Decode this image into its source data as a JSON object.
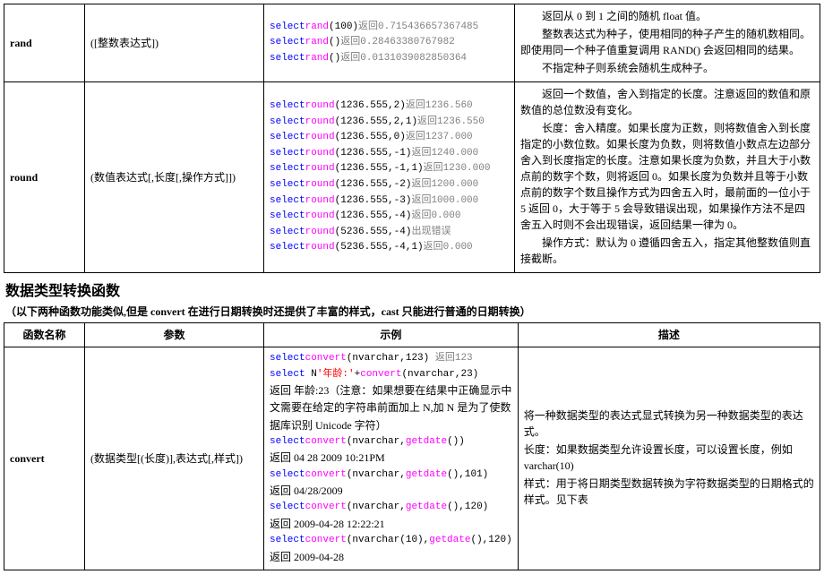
{
  "table1": {
    "rows": [
      {
        "name": "rand",
        "params": "([整数表达式])",
        "examples": [
          {
            "prefix": "select",
            "func": "rand",
            "args": "(100)",
            "ret": "返回0.715436657367485"
          },
          {
            "prefix": "select",
            "func": "rand",
            "args": "()",
            "ret": "返回0.28463380767982"
          },
          {
            "prefix": "select",
            "func": "rand",
            "args": "()",
            "ret": "返回0.0131039082850364"
          }
        ],
        "desc": [
          "　　返回从 0 到 1 之间的随机 float 值。",
          "　　整数表达式为种子，使用相同的种子产生的随机数相同。即使用同一个种子值重复调用 RAND() 会返回相同的结果。",
          "　　不指定种子则系统会随机生成种子。"
        ]
      },
      {
        "name": "round",
        "params": "(数值表达式[,长度[,操作方式]])",
        "examples": [
          {
            "prefix": "select",
            "func": "round",
            "args": "(1236.555,2)",
            "ret": "返回1236.560"
          },
          {
            "prefix": "select",
            "func": "round",
            "args": "(1236.555,2,1)",
            "ret": "返回1236.550"
          },
          {
            "prefix": "select",
            "func": "round",
            "args": "(1236.555,0)",
            "ret": "返回1237.000"
          },
          {
            "prefix": "select",
            "func": "round",
            "args": "(1236.555,-1)",
            "ret": "返回1240.000"
          },
          {
            "prefix": "select",
            "func": "round",
            "args": "(1236.555,-1,1)",
            "ret": "返回1230.000"
          },
          {
            "prefix": "select",
            "func": "round",
            "args": "(1236.555,-2)",
            "ret": "返回1200.000"
          },
          {
            "prefix": "select",
            "func": "round",
            "args": "(1236.555,-3)",
            "ret": "返回1000.000"
          },
          {
            "prefix": "select",
            "func": "round",
            "args": "(1236.555,-4)",
            "ret": "返回0.000"
          },
          {
            "prefix": "select",
            "func": "round",
            "args": "(5236.555,-4)",
            "ret": "出现错误"
          },
          {
            "prefix": "select",
            "func": "round",
            "args": "(5236.555,-4,1)",
            "ret": "返回0.000"
          }
        ],
        "desc": [
          "　　返回一个数值，舍入到指定的长度。注意返回的数值和原数值的总位数没有变化。",
          "　　长度：舍入精度。如果长度为正数，则将数值舍入到长度指定的小数位数。如果长度为负数，则将数值小数点左边部分舍入到长度指定的长度。注意如果长度为负数，并且大于小数点前的数字个数，则将返回 0。如果长度为负数并且等于小数点前的数字个数且操作方式为四舍五入时，最前面的一位小于 5 返回 0，大于等于 5 会导致错误出现，如果操作方法不是四舍五入时则不会出现错误，返回结果一律为 0。",
          "　　操作方式：默认为 0 遵循四舍五入，指定其他整数值则直接截断。"
        ]
      }
    ]
  },
  "section": {
    "title": "数据类型转换函数",
    "subtitle": "（以下两种函数功能类似,但是 convert 在进行日期转换时还提供了丰富的样式，cast 只能进行普通的日期转换）"
  },
  "table2": {
    "headers": [
      "函数名称",
      "参数",
      "示例",
      "描述"
    ],
    "row": {
      "name": "convert",
      "params": "(数据类型[(长度)],表达式[,样式])",
      "example_lines": [
        {
          "type": "code",
          "parts": [
            {
              "c": "kw-select",
              "t": "select"
            },
            {
              "c": "kw-func",
              "t": "convert"
            },
            {
              "c": "",
              "t": "(nvarchar,123) "
            },
            {
              "c": "return-text",
              "t": "返回123"
            }
          ]
        },
        {
          "type": "code",
          "parts": [
            {
              "c": "kw-select",
              "t": "select"
            },
            {
              "c": "",
              "t": " N"
            },
            {
              "c": "kw-str",
              "t": "'年龄:'"
            },
            {
              "c": "",
              "t": "+"
            },
            {
              "c": "kw-func",
              "t": "convert"
            },
            {
              "c": "",
              "t": "(nvarchar,23)"
            }
          ]
        },
        {
          "type": "plain",
          "t": "返回 年龄:23（注意：如果想要在结果中正确显示中文需要在给定的字符串前面加上 N,加 N 是为了使数据库识别 Unicode 字符）"
        },
        {
          "type": "code",
          "parts": [
            {
              "c": "kw-select",
              "t": "select"
            },
            {
              "c": "kw-func",
              "t": "convert"
            },
            {
              "c": "",
              "t": "(nvarchar,"
            },
            {
              "c": "kw-func",
              "t": "getdate"
            },
            {
              "c": "",
              "t": "())"
            }
          ]
        },
        {
          "type": "plain",
          "t": "返回 04 28 2009 10:21PM"
        },
        {
          "type": "code",
          "parts": [
            {
              "c": "kw-select",
              "t": "select"
            },
            {
              "c": "kw-func",
              "t": "convert"
            },
            {
              "c": "",
              "t": "(nvarchar,"
            },
            {
              "c": "kw-func",
              "t": "getdate"
            },
            {
              "c": "",
              "t": "(),101)"
            }
          ]
        },
        {
          "type": "plain",
          "t": "返回 04/28/2009"
        },
        {
          "type": "code",
          "parts": [
            {
              "c": "kw-select",
              "t": "select"
            },
            {
              "c": "kw-func",
              "t": "convert"
            },
            {
              "c": "",
              "t": "(nvarchar,"
            },
            {
              "c": "kw-func",
              "t": "getdate"
            },
            {
              "c": "",
              "t": "(),120)"
            }
          ]
        },
        {
          "type": "plain",
          "t": "返回 2009-04-28 12:22:21"
        },
        {
          "type": "code",
          "parts": [
            {
              "c": "kw-select",
              "t": "select"
            },
            {
              "c": "kw-func",
              "t": "convert"
            },
            {
              "c": "",
              "t": "(nvarchar(10),"
            },
            {
              "c": "kw-func",
              "t": "getdate"
            },
            {
              "c": "",
              "t": "(),120)"
            }
          ]
        },
        {
          "type": "plain",
          "t": "返回 2009-04-28"
        }
      ],
      "desc": [
        "将一种数据类型的表达式显式转换为另一种数据类型的表达式。",
        "长度：如果数据类型允许设置长度，可以设置长度，例如 varchar(10)",
        "样式：用于将日期类型数据转换为字符数据类型的日期格式的样式。见下表"
      ]
    }
  }
}
